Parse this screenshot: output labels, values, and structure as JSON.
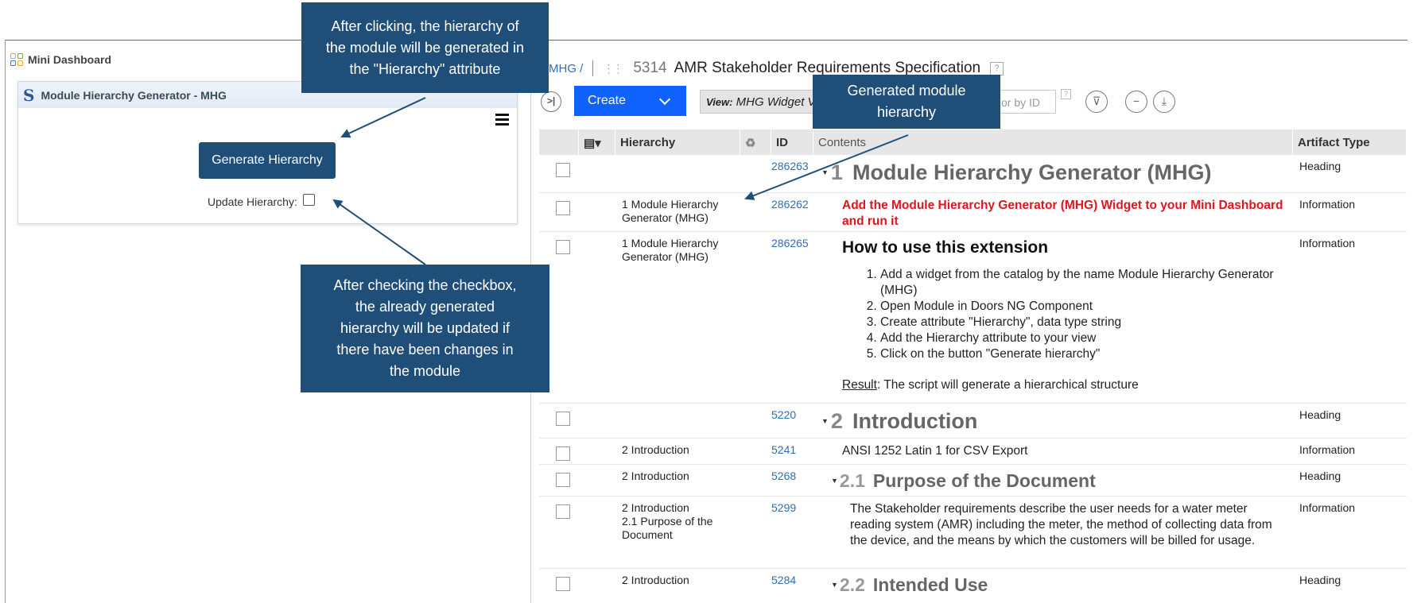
{
  "mini_dashboard": {
    "title": "Mini Dashboard",
    "widget_title": "Module Hierarchy Generator - MHG",
    "generate_button": "Generate Hierarchy",
    "update_label": "Update Hierarchy:"
  },
  "callouts": {
    "top": [
      "After clicking, the hierarchy of",
      "the module will be generated in",
      "the \"Hierarchy\" attribute"
    ],
    "bottom": [
      "After checking the checkbox,",
      "the already generated",
      "hierarchy will be updated if",
      "there have been changes in",
      "the module"
    ],
    "right": [
      "Generated module",
      "hierarchy"
    ]
  },
  "module": {
    "breadcrumb_project": "MHG /",
    "id": "5314",
    "title": "AMR Stakeholder Requirements Specification",
    "help": "?"
  },
  "toolbar": {
    "create_label": "Create",
    "view_label": "View:",
    "view_value": "MHG Widget View",
    "filter_placeholder": "or by ID"
  },
  "table": {
    "headers": {
      "hierarchy": "Hierarchy",
      "id": "ID",
      "contents": "Contents",
      "artifact_type": "Artifact Type"
    },
    "rows": [
      {
        "hierarchy": "",
        "id": "286263",
        "number": "1",
        "text": "Module Hierarchy Generator (MHG)",
        "type": "Heading"
      },
      {
        "hierarchy": "1 Module Hierarchy\nGenerator (MHG)",
        "id": "286262",
        "text": "Add the Module Hierarchy Generator (MHG) Widget to your Mini Dashboard and run it",
        "type": "Information"
      },
      {
        "hierarchy": "1 Module Hierarchy\nGenerator (MHG)",
        "id": "286265",
        "heading": "How to use this extension",
        "steps": [
          "Add a widget from the catalog by the name Module Hierarchy Generator (MHG)",
          "Open Module in Doors NG Component",
          "Create attribute \"Hierarchy\", data type string",
          "Add the Hierarchy attribute to your view",
          "Click on the button \"Generate hierarchy\""
        ],
        "result_label": "Result",
        "result_text": ": The script will generate a hierarchical structure",
        "type": "Information"
      },
      {
        "hierarchy": "",
        "id": "5220",
        "number": "2",
        "text": "Introduction",
        "type": "Heading"
      },
      {
        "hierarchy": "2 Introduction",
        "id": "5241",
        "text": "ANSI 1252 Latin 1 for CSV Export",
        "type": "Information"
      },
      {
        "hierarchy": "2 Introduction",
        "id": "5268",
        "number": "2.1",
        "text": "Purpose of the Document",
        "type": "Heading"
      },
      {
        "hierarchy": "2 Introduction\n2.1 Purpose of the\nDocument",
        "id": "5299",
        "text": "The Stakeholder requirements describe the user needs for a water meter reading system (AMR) including the meter, the method of collecting data from the device, and the means by which the customers will be billed for usage.",
        "type": "Information"
      },
      {
        "hierarchy": "2 Introduction",
        "id": "5284",
        "number": "2.2",
        "text": "Intended Use",
        "type": "Heading"
      }
    ]
  }
}
